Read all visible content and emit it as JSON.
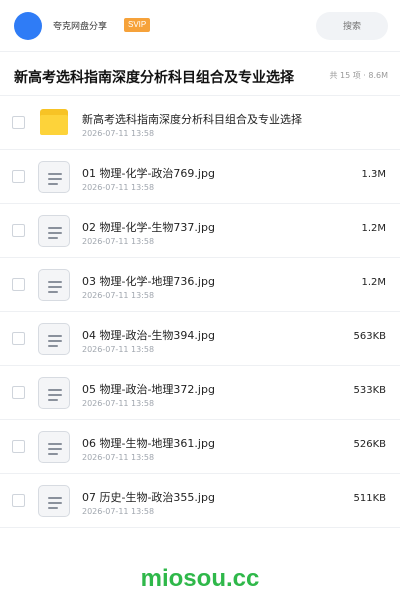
{
  "header": {
    "share_title": "夸克网盘分享",
    "badge": "SVIP",
    "search_placeholder": "搜索"
  },
  "folder": {
    "title": "新高考选科指南深度分析科目组合及专业选择",
    "meta": "共 15 项 · 8.6M"
  },
  "items": [
    {
      "type": "folder",
      "name": "新高考选科指南深度分析科目组合及专业选择",
      "date": "2026-07-11 13:58",
      "size": ""
    },
    {
      "type": "file",
      "name": "01 物理-化学-政治769.jpg",
      "date": "2026-07-11 13:58",
      "size": "1.3M"
    },
    {
      "type": "file",
      "name": "02 物理-化学-生物737.jpg",
      "date": "2026-07-11 13:58",
      "size": "1.2M"
    },
    {
      "type": "file",
      "name": "03 物理-化学-地理736.jpg",
      "date": "2026-07-11 13:58",
      "size": "1.2M"
    },
    {
      "type": "file",
      "name": "04 物理-政治-生物394.jpg",
      "date": "2026-07-11 13:58",
      "size": "563KB"
    },
    {
      "type": "file",
      "name": "05 物理-政治-地理372.jpg",
      "date": "2026-07-11 13:58",
      "size": "533KB"
    },
    {
      "type": "file",
      "name": "06 物理-生物-地理361.jpg",
      "date": "2026-07-11 13:58",
      "size": "526KB"
    },
    {
      "type": "file",
      "name": "07 历史-生物-政治355.jpg",
      "date": "2026-07-11 13:58",
      "size": "511KB"
    }
  ],
  "footer": {
    "watermark": "miosou.cc"
  },
  "colors": {
    "avatar": "#2f7cf6",
    "badge": "#f6a23a",
    "watermark": "#2fb84a"
  }
}
